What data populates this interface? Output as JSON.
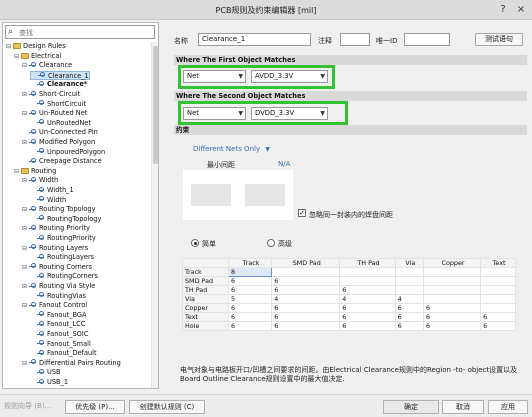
{
  "window": {
    "title": "PCB规则及约束编辑器 [mil]",
    "help": "?",
    "close": "×"
  },
  "search": {
    "placeholder": "查找"
  },
  "tree": [
    {
      "label": "Design Rules",
      "level": 0,
      "toggle": "⊟",
      "icon": "folder",
      "bold": false
    },
    {
      "label": "Electrical",
      "level": 1,
      "toggle": "⊟",
      "icon": "folder",
      "bold": false
    },
    {
      "label": "Clearance",
      "level": 2,
      "toggle": "⊟",
      "icon": "rule",
      "bold": false
    },
    {
      "label": "Clearance_1",
      "level": 3,
      "toggle": "",
      "icon": "rule",
      "bold": false,
      "selected": true
    },
    {
      "label": "Clearance*",
      "level": 3,
      "toggle": "",
      "icon": "rule",
      "bold": true
    },
    {
      "label": "Short-Circuit",
      "level": 2,
      "toggle": "⊟",
      "icon": "rule",
      "bold": false
    },
    {
      "label": "ShortCircuit",
      "level": 3,
      "toggle": "",
      "icon": "rule",
      "bold": false
    },
    {
      "label": "Un-Routed Net",
      "level": 2,
      "toggle": "⊟",
      "icon": "rule",
      "bold": false
    },
    {
      "label": "UnRoutedNet",
      "level": 3,
      "toggle": "",
      "icon": "rule",
      "bold": false
    },
    {
      "label": "Un-Connected Pin",
      "level": 2,
      "toggle": "",
      "icon": "rule",
      "bold": false
    },
    {
      "label": "Modified Polygon",
      "level": 2,
      "toggle": "⊟",
      "icon": "rule",
      "bold": false
    },
    {
      "label": "UnpouredPolygon",
      "level": 3,
      "toggle": "",
      "icon": "rule",
      "bold": false
    },
    {
      "label": "Creepage Distance",
      "level": 2,
      "toggle": "",
      "icon": "rule",
      "bold": false
    },
    {
      "label": "Routing",
      "level": 1,
      "toggle": "⊟",
      "icon": "folder",
      "bold": false
    },
    {
      "label": "Width",
      "level": 2,
      "toggle": "⊟",
      "icon": "rule",
      "bold": false
    },
    {
      "label": "Width_1",
      "level": 3,
      "toggle": "",
      "icon": "rule",
      "bold": false
    },
    {
      "label": "Width",
      "level": 3,
      "toggle": "",
      "icon": "rule",
      "bold": false
    },
    {
      "label": "Routing Topology",
      "level": 2,
      "toggle": "⊟",
      "icon": "rule",
      "bold": false
    },
    {
      "label": "RoutingTopology",
      "level": 3,
      "toggle": "",
      "icon": "rule",
      "bold": false
    },
    {
      "label": "Routing Priority",
      "level": 2,
      "toggle": "⊟",
      "icon": "rule",
      "bold": false
    },
    {
      "label": "RoutingPriority",
      "level": 3,
      "toggle": "",
      "icon": "rule",
      "bold": false
    },
    {
      "label": "Routing Layers",
      "level": 2,
      "toggle": "⊟",
      "icon": "rule",
      "bold": false
    },
    {
      "label": "RoutingLayers",
      "level": 3,
      "toggle": "",
      "icon": "rule",
      "bold": false
    },
    {
      "label": "Routing Corners",
      "level": 2,
      "toggle": "⊟",
      "icon": "rule",
      "bold": false
    },
    {
      "label": "RoutingCorners",
      "level": 3,
      "toggle": "",
      "icon": "rule",
      "bold": false
    },
    {
      "label": "Routing Via Style",
      "level": 2,
      "toggle": "⊟",
      "icon": "rule",
      "bold": false
    },
    {
      "label": "RoutingVias",
      "level": 3,
      "toggle": "",
      "icon": "rule",
      "bold": false
    },
    {
      "label": "Fanout Control",
      "level": 2,
      "toggle": "⊟",
      "icon": "rule",
      "bold": false
    },
    {
      "label": "Fanout_BGA",
      "level": 3,
      "toggle": "",
      "icon": "rule",
      "bold": false
    },
    {
      "label": "Fanout_LCC",
      "level": 3,
      "toggle": "",
      "icon": "rule",
      "bold": false
    },
    {
      "label": "Fanout_SOIC",
      "level": 3,
      "toggle": "",
      "icon": "rule",
      "bold": false
    },
    {
      "label": "Fanout_Small",
      "level": 3,
      "toggle": "",
      "icon": "rule",
      "bold": false
    },
    {
      "label": "Fanout_Default",
      "level": 3,
      "toggle": "",
      "icon": "rule",
      "bold": false
    },
    {
      "label": "Differential Pairs Routing",
      "level": 2,
      "toggle": "⊟",
      "icon": "rule",
      "bold": false
    },
    {
      "label": "USB",
      "level": 3,
      "toggle": "",
      "icon": "rule",
      "bold": false
    },
    {
      "label": "USB_1",
      "level": 3,
      "toggle": "",
      "icon": "rule",
      "bold": false
    }
  ],
  "rule": {
    "name_label": "名称",
    "name_value": "Clearance_1",
    "comment_label": "注释",
    "comment_value": "",
    "uid_label": "唯一ID",
    "uid_value": "",
    "test_button": "测试语句"
  },
  "first_match": {
    "header": "Where The First Object Matches",
    "scope": "Net",
    "value": "AVDD_3.3V"
  },
  "second_match": {
    "header": "Where The Second Object Matches",
    "scope": "Net",
    "value": "DVDD_3.3V"
  },
  "constraints": {
    "header": "约束",
    "nets_option": "Different Nets Only",
    "min_clearance_label": "最小间距",
    "min_clearance_value": "N/A",
    "ignore_pads_label": "忽略同一封装内的焊盘间距",
    "ignore_pads_checked": true,
    "mode_simple": "简单",
    "mode_advanced": "高级",
    "mode_selected": "simple"
  },
  "matrix": {
    "columns": [
      "",
      "Track",
      "SMD Pad",
      "TH Pad",
      "Via",
      "Copper",
      "Text"
    ],
    "rows": [
      {
        "name": "Track",
        "cells": [
          "8",
          "",
          "",
          "",
          "",
          ""
        ]
      },
      {
        "name": "SMD Pad",
        "cells": [
          "6",
          "6",
          "",
          "",
          "",
          ""
        ]
      },
      {
        "name": "TH Pad",
        "cells": [
          "6",
          "6",
          "6",
          "",
          "",
          ""
        ]
      },
      {
        "name": "Via",
        "cells": [
          "5",
          "4",
          "4",
          "4",
          "",
          ""
        ]
      },
      {
        "name": "Copper",
        "cells": [
          "6",
          "6",
          "6",
          "6",
          "6",
          ""
        ]
      },
      {
        "name": "Text",
        "cells": [
          "6",
          "6",
          "6",
          "6",
          "6",
          "6"
        ]
      },
      {
        "name": "Hole",
        "cells": [
          "6",
          "6",
          "6",
          "6",
          "6",
          "6"
        ]
      }
    ]
  },
  "note": "电气对象与电路板开口/凹槽之间要求的间距。由Electrical Clearance规则中的Region -to- object设置以及Board Outline Clearance规则设置中的最大值决定.",
  "bottom": {
    "wizard": "规则向导 (B)...",
    "priority": "优先级 (P)...",
    "create_default": "创建默认规则 (C)",
    "ok": "确定",
    "cancel": "取消",
    "apply": "应用"
  }
}
